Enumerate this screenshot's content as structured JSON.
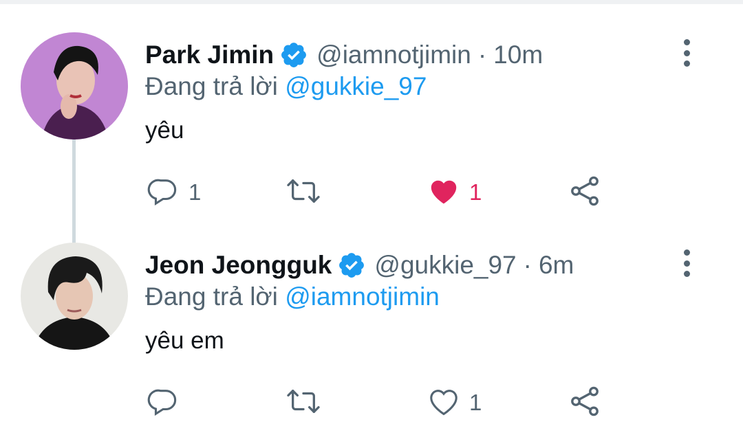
{
  "thread": [
    {
      "author_name": "Park Jimin",
      "handle": "@iamnotjimin",
      "separator": "·",
      "time": "10m",
      "replying_prefix": "Đang trả lời",
      "replying_to": "@gukkie_97",
      "text": "yêu",
      "reply_count": "1",
      "retweet_count": "",
      "like_count": "1",
      "liked": true,
      "avatar_bg": "#c98bd6"
    },
    {
      "author_name": "Jeon Jeongguk",
      "handle": "@gukkie_97",
      "separator": "·",
      "time": "6m",
      "replying_prefix": "Đang trả lời",
      "replying_to": "@iamnotjimin",
      "text": "yêu em",
      "reply_count": "",
      "retweet_count": "",
      "like_count": "1",
      "liked": false,
      "avatar_bg": "#e8e8e4"
    }
  ],
  "colors": {
    "accent": "#1d9bf0",
    "like": "#e0245e",
    "text": "#0f1419",
    "secondary": "#536471"
  },
  "icons": {
    "verified": "verified-badge-icon",
    "more": "more-options-icon",
    "reply": "reply-icon",
    "retweet": "retweet-icon",
    "like": "heart-icon",
    "share": "share-icon"
  }
}
